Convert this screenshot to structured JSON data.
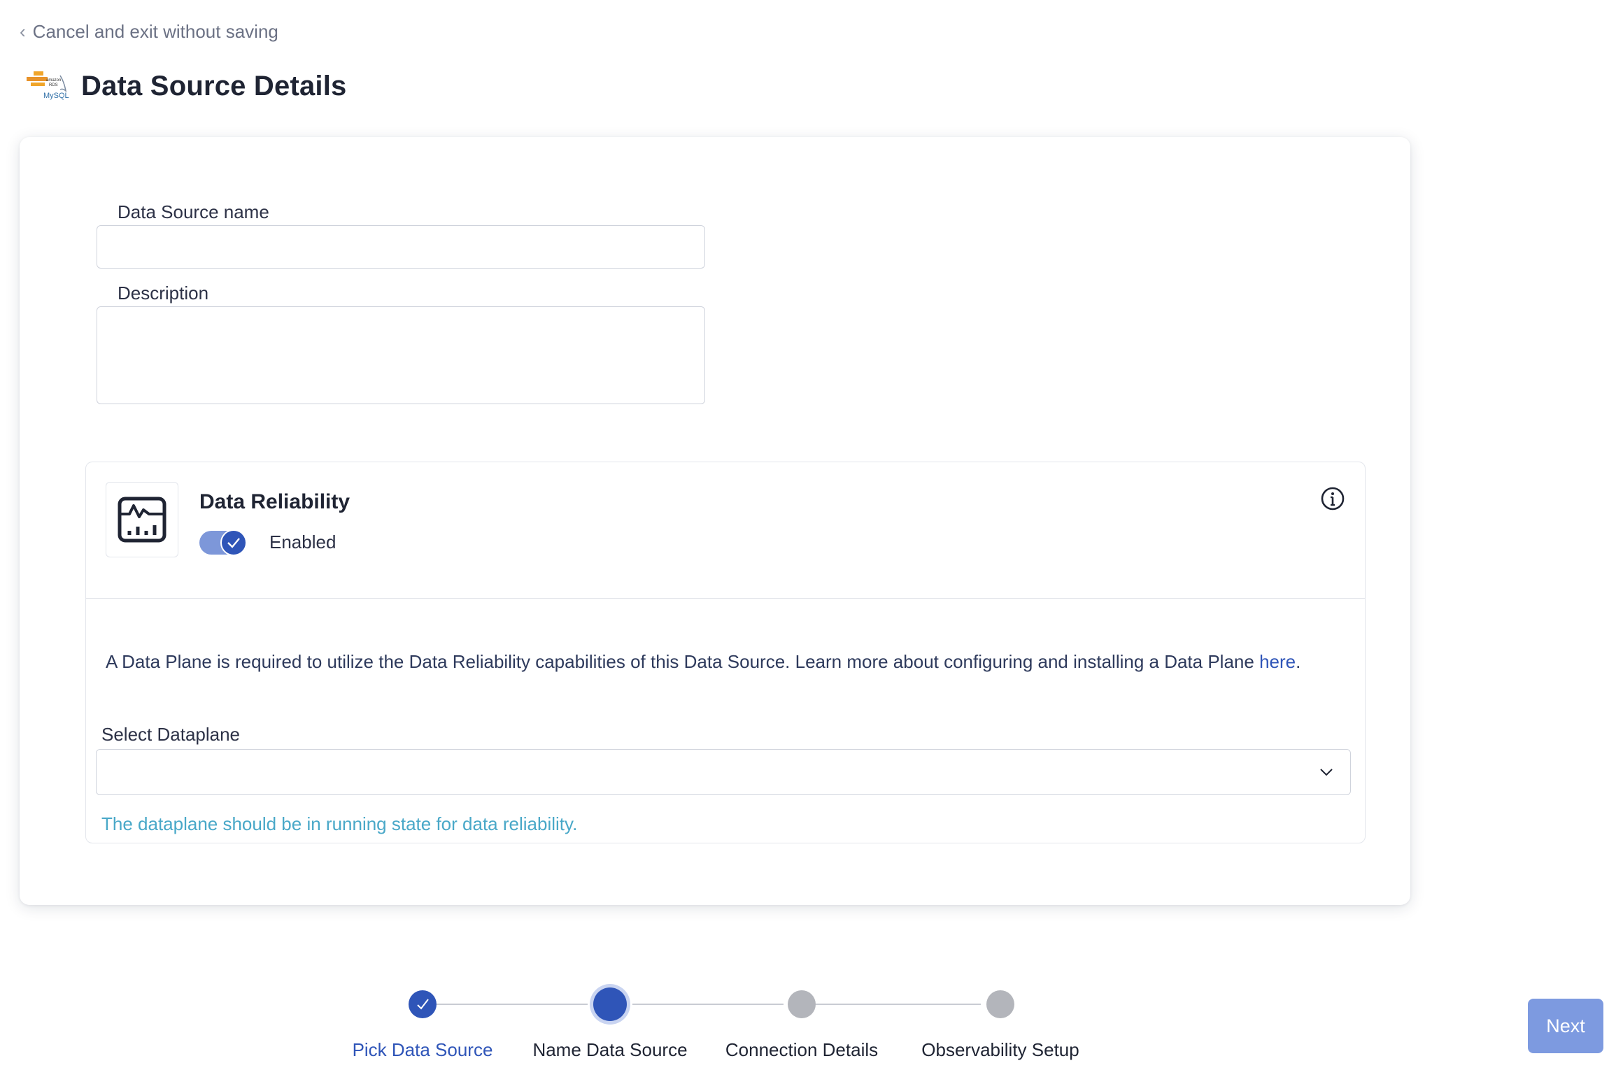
{
  "nav": {
    "back_label": "Cancel and exit without saving"
  },
  "header": {
    "title": "Data Source Details",
    "logo_icon": "amazon-rds-mysql-logo",
    "logo_text": "MySQL"
  },
  "form": {
    "name_label": "Data Source name",
    "name_value": "",
    "description_label": "Description",
    "description_value": ""
  },
  "reliability": {
    "icon": "chart-monitor-icon",
    "title": "Data Reliability",
    "toggle_enabled": true,
    "toggle_label": "Enabled",
    "notice_text": "A Data Plane is required to utilize the Data Reliability capabilities of this Data Source. Learn more about configuring and installing a Data Plane ",
    "notice_link": "here",
    "notice_end": ".",
    "select_label": "Select Dataplane",
    "select_value": "",
    "hint": "The dataplane should be in running state for data reliability."
  },
  "stepper": {
    "steps": [
      {
        "label": "Pick Data Source",
        "state": "completed"
      },
      {
        "label": "Name Data Source",
        "state": "current"
      },
      {
        "label": "Connection Details",
        "state": "pending"
      },
      {
        "label": "Observability Setup",
        "state": "pending"
      }
    ]
  },
  "footer": {
    "next_label": "Next"
  },
  "colors": {
    "primary": "#2f55b8",
    "primary_light": "#7d9ae0",
    "hint": "#49a8c8",
    "pending": "#b3b5bb"
  }
}
